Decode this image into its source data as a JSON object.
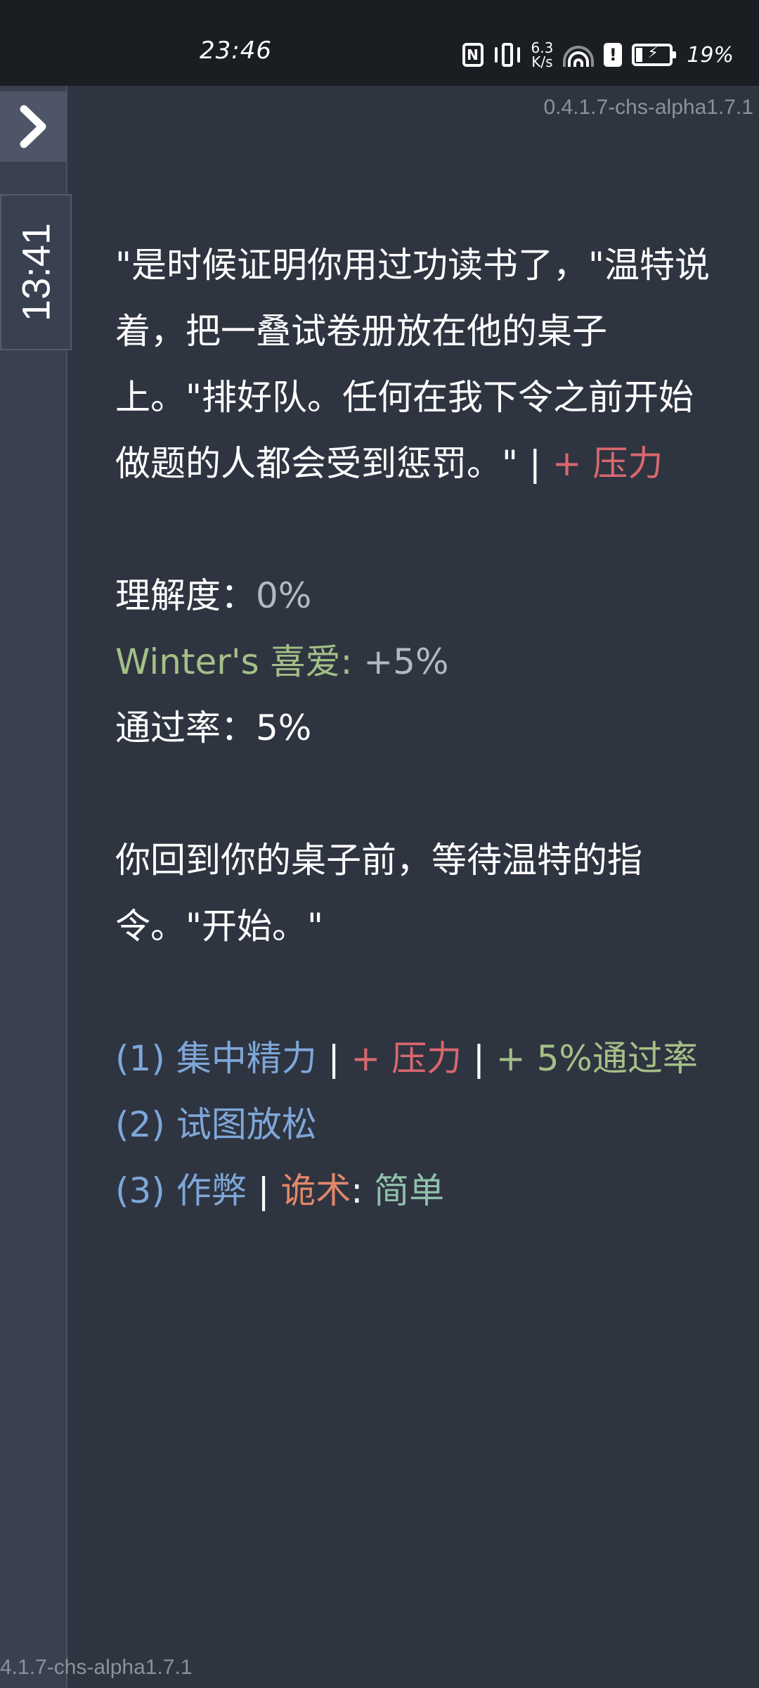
{
  "status_bar": {
    "time": "23:46",
    "net_speed_value": "6.3",
    "net_speed_unit": "K/s",
    "battery": "19%",
    "icons": [
      "nfc-icon",
      "vibrate-icon",
      "wifi-icon",
      "alert-icon",
      "battery-charging-icon"
    ]
  },
  "sidebar": {
    "toggle_icon": "chevron-right-icon",
    "clock": "13:41"
  },
  "version": "0.4.1.7-chs-alpha1.7.1",
  "version_bottom": "4.1.7-chs-alpha1.7.1",
  "story": {
    "paragraph": "\"是时候证明你用过功读书了，\"温特说着，把一叠试卷册放在他的桌子上。\"排好队。任何在我下令之前开始做题的人都会受到惩罚。\"",
    "separator": " | ",
    "effect": "+ 压力"
  },
  "stats": {
    "understanding_label": "理解度：",
    "understanding_value": "0%",
    "affection_label": "Winter's 喜爱:",
    "affection_value": " +5%",
    "pass_rate_label": "通过率：",
    "pass_rate_value": "5%"
  },
  "story2": {
    "paragraph": "你回到你的桌子前，等待温特的指令。\"开始。\""
  },
  "choices": [
    {
      "label": "(1) 集中精力",
      "sep1": " | ",
      "effect1": "+ 压力",
      "sep2": " | ",
      "effect2": "+ 5%通过率"
    },
    {
      "label": "(2) 试图放松"
    },
    {
      "label": "(3) 作弊",
      "sep1": " | ",
      "skill": "诡术",
      "colon": ": ",
      "difficulty": "简单"
    }
  ],
  "colors": {
    "background": "#2f3441",
    "stress": "#d9686e",
    "positive": "#a3c086",
    "choice": "#7ea7d8",
    "skill": "#e2876a",
    "difficulty": "#8fc0aa"
  }
}
